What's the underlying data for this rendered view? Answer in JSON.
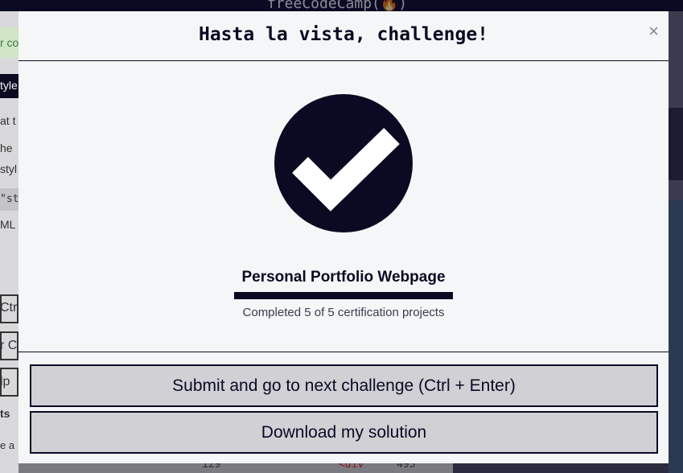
{
  "background": {
    "brand": "freeCodeCamp(🔥)",
    "left_fragments": [
      "r co",
      "tyle",
      "at t",
      "he",
      "styl",
      "\"st",
      "ML",
      "Ctr",
      "r C",
      "lp",
      "ts",
      "e a"
    ],
    "line_number": "129",
    "code_fragment": "<div",
    "right_number": "495"
  },
  "modal": {
    "title": "Hasta la vista, challenge!",
    "close_label": "×",
    "icon": "checkmark-icon",
    "project_title": "Personal Portfolio Webpage",
    "progress": {
      "completed": 5,
      "total": 5
    },
    "progress_text": "Completed 5 of 5 certification projects",
    "submit_label": "Submit and go to next challenge (Ctrl + Enter)",
    "download_label": "Download my solution"
  },
  "colors": {
    "accent": "#0a0a23",
    "modal_bg": "#f5f6f7",
    "button_bg": "#d0d0d5"
  }
}
